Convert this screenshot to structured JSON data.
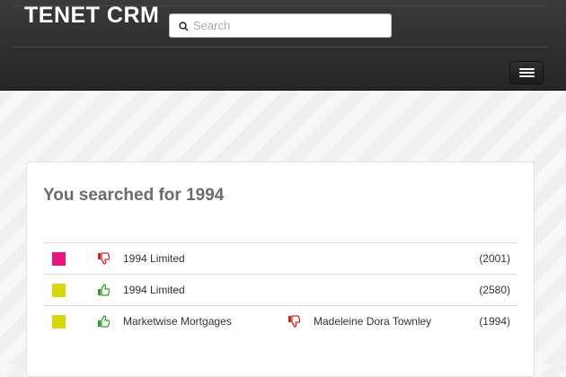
{
  "header": {
    "brand": "TENET CRM",
    "search": {
      "placeholder": "Search",
      "value": "",
      "icon": "search-icon"
    },
    "menu_icon": "hamburger-menu-icon"
  },
  "main": {
    "heading": "You searched for 1994",
    "results": [
      {
        "color": "#e6157f",
        "thumb": "thumbs-down-icon",
        "name": "1994 Limited",
        "related_thumb": "",
        "related_name": "",
        "number": "(2001)"
      },
      {
        "color": "#d6d60a",
        "thumb": "thumbs-up-icon",
        "name": "1994 Limited",
        "related_thumb": "",
        "related_name": "",
        "number": "(2580)"
      },
      {
        "color": "#d6d60a",
        "thumb": "thumbs-up-icon",
        "name": "Marketwise Mortgages",
        "related_thumb": "thumbs-down-icon",
        "related_name": "Madeleine Dora Townley",
        "number": "(1994)"
      }
    ]
  },
  "colors": {
    "thumbs_up": "#2e9a2e",
    "thumbs_down": "#d42020",
    "topbar": "#2c2c2c"
  }
}
